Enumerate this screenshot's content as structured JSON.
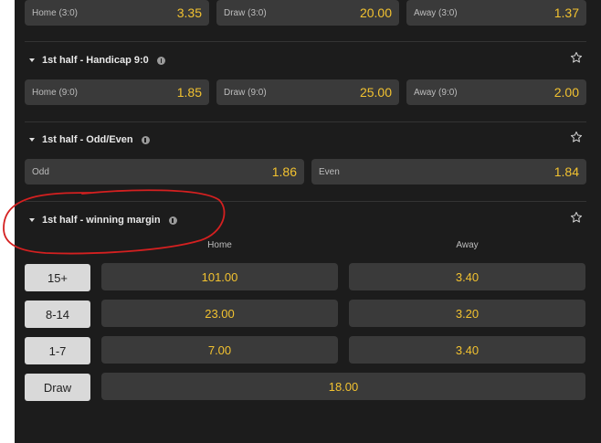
{
  "top_row": [
    {
      "label": "Home (3:0)",
      "value": "3.35"
    },
    {
      "label": "Draw (3:0)",
      "value": "20.00"
    },
    {
      "label": "Away (3:0)",
      "value": "1.37"
    }
  ],
  "handicap": {
    "title": "1st half - Handicap 9:0",
    "odds": [
      {
        "label": "Home (9:0)",
        "value": "1.85"
      },
      {
        "label": "Draw (9:0)",
        "value": "25.00"
      },
      {
        "label": "Away (9:0)",
        "value": "2.00"
      }
    ]
  },
  "odd_even": {
    "title": "1st half - Odd/Even",
    "odds": [
      {
        "label": "Odd",
        "value": "1.86"
      },
      {
        "label": "Even",
        "value": "1.84"
      }
    ]
  },
  "winning_margin": {
    "title": "1st half - winning margin",
    "col_home": "Home",
    "col_away": "Away",
    "rows": [
      {
        "label": "15+",
        "home": "101.00",
        "away": "3.40"
      },
      {
        "label": "8-14",
        "home": "23.00",
        "away": "3.20"
      },
      {
        "label": "1-7",
        "home": "7.00",
        "away": "3.40"
      }
    ],
    "draw": {
      "label": "Draw",
      "value": "18.00"
    }
  },
  "colors": {
    "odds_accent": "#f2c230",
    "annotation": "#d42020"
  }
}
